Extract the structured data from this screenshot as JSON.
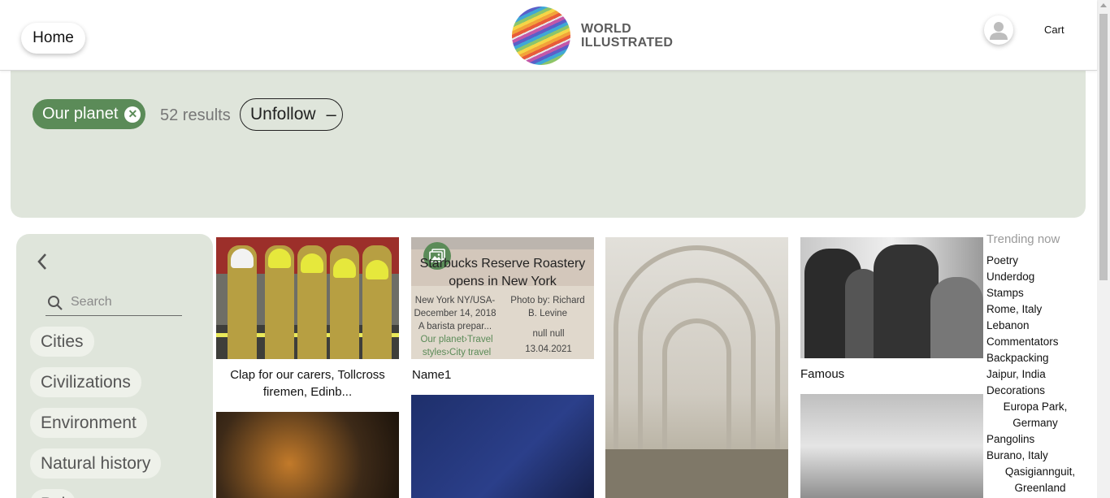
{
  "header": {
    "home_label": "Home",
    "logo_line1": "WORLD",
    "logo_line2": "ILLUSTRATED",
    "cart_label": "Cart"
  },
  "filter": {
    "chip_label": "Our planet",
    "results_text": "52 results",
    "unfollow_label": "Unfollow",
    "unfollow_icon": "–"
  },
  "sidebar": {
    "search_placeholder": "Search",
    "categories": [
      "Cities",
      "Civilizations",
      "Environment",
      "Natural history",
      "Pol"
    ]
  },
  "cards": {
    "card1_caption": "Clap for our carers, Tollcross firemen, Edinb...",
    "card2_caption": "Name1",
    "card2_overlay": {
      "title": "Starbucks Reserve Roastery opens in New York",
      "description": "New York NY/USA- December 14, 2018 A barista prepar...",
      "photo_by": "Photo by: Richard B. Levine",
      "tags": "Our planet›Travel styles›City travel",
      "null_text": "null null",
      "date": "13.04.2021"
    },
    "card4_caption": "Famous"
  },
  "trending": {
    "title": "Trending now",
    "items": [
      "Poetry",
      "Underdog",
      "Stamps",
      "Rome, Italy",
      "Lebanon",
      "Commentators",
      "Backpacking",
      "Jaipur, India",
      "Decorations",
      "Europa Park, Germany",
      "Pangolins",
      "Burano, Italy",
      "Qasigiannguit, Greenland"
    ]
  },
  "colors": {
    "accent_green": "#5b8b58",
    "panel_green": "#dfe5db"
  },
  "icons": {
    "chip_close": "close-circle-icon",
    "back": "chevron-left-icon",
    "search": "search-icon",
    "gallery": "image-gallery-icon",
    "avatar": "user-avatar-icon"
  }
}
